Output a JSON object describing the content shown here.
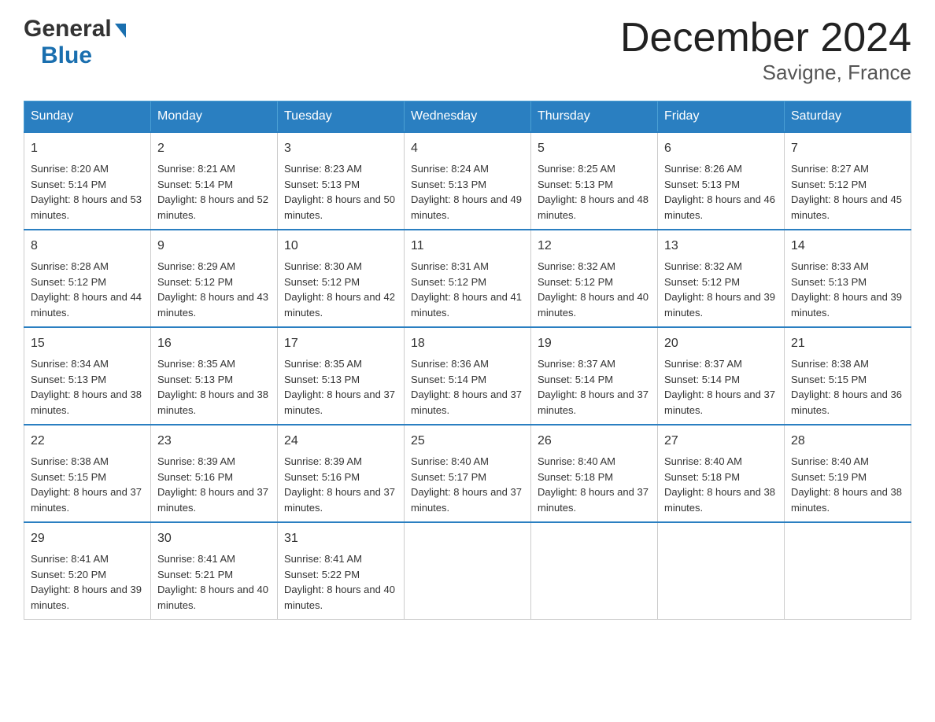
{
  "header": {
    "logo_general": "General",
    "logo_blue": "Blue",
    "title": "December 2024",
    "subtitle": "Savigne, France"
  },
  "days_of_week": [
    "Sunday",
    "Monday",
    "Tuesday",
    "Wednesday",
    "Thursday",
    "Friday",
    "Saturday"
  ],
  "weeks": [
    [
      {
        "num": "1",
        "sunrise": "Sunrise: 8:20 AM",
        "sunset": "Sunset: 5:14 PM",
        "daylight": "Daylight: 8 hours and 53 minutes."
      },
      {
        "num": "2",
        "sunrise": "Sunrise: 8:21 AM",
        "sunset": "Sunset: 5:14 PM",
        "daylight": "Daylight: 8 hours and 52 minutes."
      },
      {
        "num": "3",
        "sunrise": "Sunrise: 8:23 AM",
        "sunset": "Sunset: 5:13 PM",
        "daylight": "Daylight: 8 hours and 50 minutes."
      },
      {
        "num": "4",
        "sunrise": "Sunrise: 8:24 AM",
        "sunset": "Sunset: 5:13 PM",
        "daylight": "Daylight: 8 hours and 49 minutes."
      },
      {
        "num": "5",
        "sunrise": "Sunrise: 8:25 AM",
        "sunset": "Sunset: 5:13 PM",
        "daylight": "Daylight: 8 hours and 48 minutes."
      },
      {
        "num": "6",
        "sunrise": "Sunrise: 8:26 AM",
        "sunset": "Sunset: 5:13 PM",
        "daylight": "Daylight: 8 hours and 46 minutes."
      },
      {
        "num": "7",
        "sunrise": "Sunrise: 8:27 AM",
        "sunset": "Sunset: 5:12 PM",
        "daylight": "Daylight: 8 hours and 45 minutes."
      }
    ],
    [
      {
        "num": "8",
        "sunrise": "Sunrise: 8:28 AM",
        "sunset": "Sunset: 5:12 PM",
        "daylight": "Daylight: 8 hours and 44 minutes."
      },
      {
        "num": "9",
        "sunrise": "Sunrise: 8:29 AM",
        "sunset": "Sunset: 5:12 PM",
        "daylight": "Daylight: 8 hours and 43 minutes."
      },
      {
        "num": "10",
        "sunrise": "Sunrise: 8:30 AM",
        "sunset": "Sunset: 5:12 PM",
        "daylight": "Daylight: 8 hours and 42 minutes."
      },
      {
        "num": "11",
        "sunrise": "Sunrise: 8:31 AM",
        "sunset": "Sunset: 5:12 PM",
        "daylight": "Daylight: 8 hours and 41 minutes."
      },
      {
        "num": "12",
        "sunrise": "Sunrise: 8:32 AM",
        "sunset": "Sunset: 5:12 PM",
        "daylight": "Daylight: 8 hours and 40 minutes."
      },
      {
        "num": "13",
        "sunrise": "Sunrise: 8:32 AM",
        "sunset": "Sunset: 5:12 PM",
        "daylight": "Daylight: 8 hours and 39 minutes."
      },
      {
        "num": "14",
        "sunrise": "Sunrise: 8:33 AM",
        "sunset": "Sunset: 5:13 PM",
        "daylight": "Daylight: 8 hours and 39 minutes."
      }
    ],
    [
      {
        "num": "15",
        "sunrise": "Sunrise: 8:34 AM",
        "sunset": "Sunset: 5:13 PM",
        "daylight": "Daylight: 8 hours and 38 minutes."
      },
      {
        "num": "16",
        "sunrise": "Sunrise: 8:35 AM",
        "sunset": "Sunset: 5:13 PM",
        "daylight": "Daylight: 8 hours and 38 minutes."
      },
      {
        "num": "17",
        "sunrise": "Sunrise: 8:35 AM",
        "sunset": "Sunset: 5:13 PM",
        "daylight": "Daylight: 8 hours and 37 minutes."
      },
      {
        "num": "18",
        "sunrise": "Sunrise: 8:36 AM",
        "sunset": "Sunset: 5:14 PM",
        "daylight": "Daylight: 8 hours and 37 minutes."
      },
      {
        "num": "19",
        "sunrise": "Sunrise: 8:37 AM",
        "sunset": "Sunset: 5:14 PM",
        "daylight": "Daylight: 8 hours and 37 minutes."
      },
      {
        "num": "20",
        "sunrise": "Sunrise: 8:37 AM",
        "sunset": "Sunset: 5:14 PM",
        "daylight": "Daylight: 8 hours and 37 minutes."
      },
      {
        "num": "21",
        "sunrise": "Sunrise: 8:38 AM",
        "sunset": "Sunset: 5:15 PM",
        "daylight": "Daylight: 8 hours and 36 minutes."
      }
    ],
    [
      {
        "num": "22",
        "sunrise": "Sunrise: 8:38 AM",
        "sunset": "Sunset: 5:15 PM",
        "daylight": "Daylight: 8 hours and 37 minutes."
      },
      {
        "num": "23",
        "sunrise": "Sunrise: 8:39 AM",
        "sunset": "Sunset: 5:16 PM",
        "daylight": "Daylight: 8 hours and 37 minutes."
      },
      {
        "num": "24",
        "sunrise": "Sunrise: 8:39 AM",
        "sunset": "Sunset: 5:16 PM",
        "daylight": "Daylight: 8 hours and 37 minutes."
      },
      {
        "num": "25",
        "sunrise": "Sunrise: 8:40 AM",
        "sunset": "Sunset: 5:17 PM",
        "daylight": "Daylight: 8 hours and 37 minutes."
      },
      {
        "num": "26",
        "sunrise": "Sunrise: 8:40 AM",
        "sunset": "Sunset: 5:18 PM",
        "daylight": "Daylight: 8 hours and 37 minutes."
      },
      {
        "num": "27",
        "sunrise": "Sunrise: 8:40 AM",
        "sunset": "Sunset: 5:18 PM",
        "daylight": "Daylight: 8 hours and 38 minutes."
      },
      {
        "num": "28",
        "sunrise": "Sunrise: 8:40 AM",
        "sunset": "Sunset: 5:19 PM",
        "daylight": "Daylight: 8 hours and 38 minutes."
      }
    ],
    [
      {
        "num": "29",
        "sunrise": "Sunrise: 8:41 AM",
        "sunset": "Sunset: 5:20 PM",
        "daylight": "Daylight: 8 hours and 39 minutes."
      },
      {
        "num": "30",
        "sunrise": "Sunrise: 8:41 AM",
        "sunset": "Sunset: 5:21 PM",
        "daylight": "Daylight: 8 hours and 40 minutes."
      },
      {
        "num": "31",
        "sunrise": "Sunrise: 8:41 AM",
        "sunset": "Sunset: 5:22 PM",
        "daylight": "Daylight: 8 hours and 40 minutes."
      },
      {
        "num": "",
        "sunrise": "",
        "sunset": "",
        "daylight": ""
      },
      {
        "num": "",
        "sunrise": "",
        "sunset": "",
        "daylight": ""
      },
      {
        "num": "",
        "sunrise": "",
        "sunset": "",
        "daylight": ""
      },
      {
        "num": "",
        "sunrise": "",
        "sunset": "",
        "daylight": ""
      }
    ]
  ]
}
